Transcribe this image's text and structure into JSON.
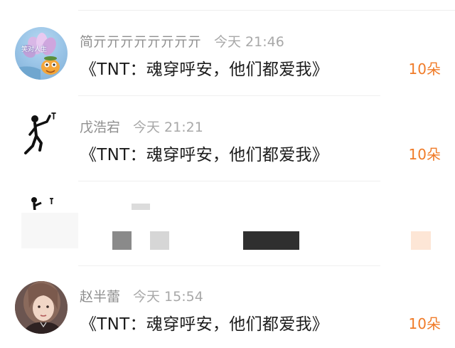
{
  "comments": [
    {
      "name": "简亓亓亓亓亓亓亓亓",
      "time": "今天 21:46",
      "title": "《TNT：魂穿呼安，他们都爱我》",
      "count": "10朵",
      "avatar_text": "笑对人生"
    },
    {
      "name": "戊浩宕",
      "time": "今天 21:21",
      "title": "《TNT：魂穿呼安，他们都爱我》",
      "count": "10朵"
    },
    {
      "name": "赵半蕾",
      "time": "今天 15:54",
      "title": "《TNT：魂穿呼安，他们都爱我》",
      "count": "10朵"
    }
  ],
  "colors": {
    "accent_orange": "#f07b28",
    "name_gray": "#8f8f8f",
    "title_black": "#1c1c1c"
  }
}
